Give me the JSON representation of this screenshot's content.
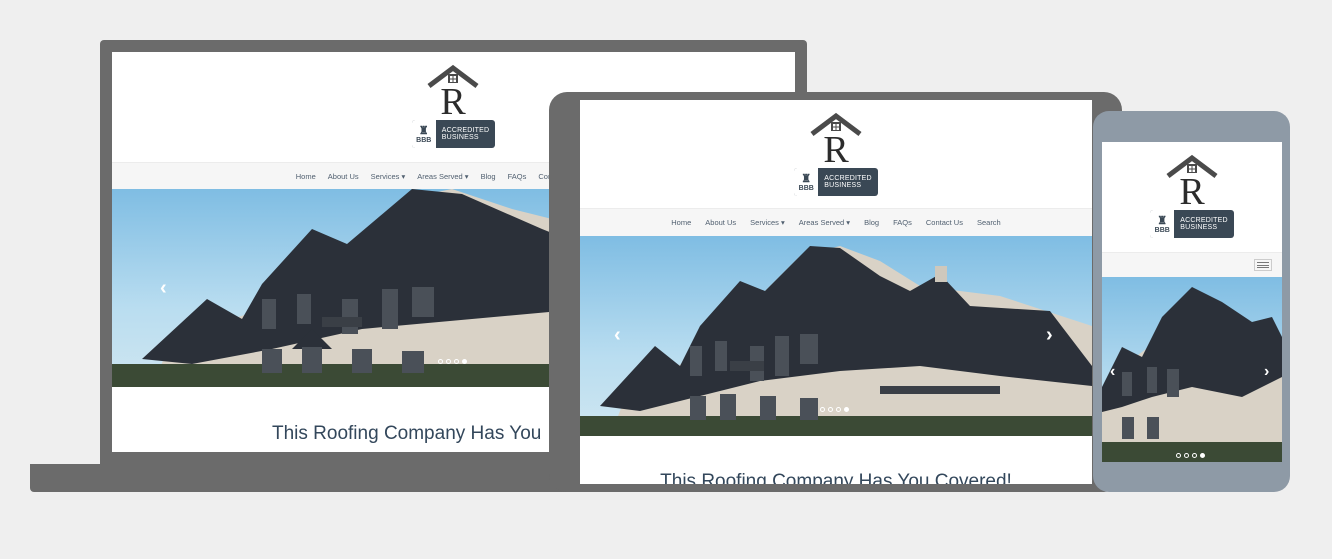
{
  "brand": {
    "logo_letter": "R",
    "bbb_seal": "BBB",
    "bbb_line1": "ACCREDITED",
    "bbb_line2": "BUSINESS"
  },
  "nav": {
    "items": [
      "Home",
      "About Us",
      "Services",
      "Areas Served",
      "Blog",
      "FAQs",
      "Contact Us",
      "Search"
    ],
    "dropdown_items": [
      "Services",
      "Areas Served"
    ]
  },
  "hero": {
    "prev_arrow": "‹",
    "next_arrow": "›",
    "slide_count": 4,
    "active_slide": 4
  },
  "content": {
    "headline_laptop": "This Roofing Company Has You",
    "headline_tablet": "This Roofing Company Has You Covered!"
  },
  "colors": {
    "frame": "#6b6b6b",
    "phone_frame": "#8e9aa6",
    "sky": "#7fbde3",
    "roof": "#2b3039",
    "wall": "#d9d2c6",
    "heading": "#33475b",
    "bbb": "#3a4855"
  },
  "icons": [
    "house-logo-icon",
    "bbb-torch-icon",
    "chevron-left-icon",
    "chevron-right-icon",
    "menu-icon"
  ]
}
